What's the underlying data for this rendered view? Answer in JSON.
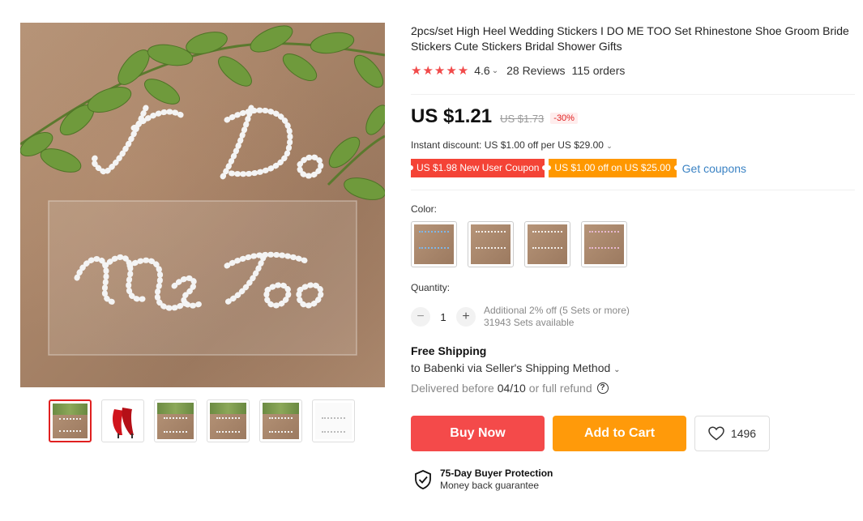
{
  "gallery": {
    "main_image": "rhinestone-stickers-i-do-me-too-photo",
    "thumbnails": [
      {
        "name": "thumb-1",
        "kind": "stickers",
        "active": true
      },
      {
        "name": "thumb-2",
        "kind": "red-heels",
        "active": false
      },
      {
        "name": "thumb-3",
        "kind": "stickers",
        "active": false
      },
      {
        "name": "thumb-4",
        "kind": "stickers",
        "active": false
      },
      {
        "name": "thumb-5",
        "kind": "stickers",
        "active": false
      },
      {
        "name": "thumb-6",
        "kind": "stickers-white",
        "active": false
      }
    ]
  },
  "product": {
    "title": "2pcs/set High Heel Wedding Stickers I DO ME TOO Set Rhinestone Shoe Groom Bride Stickers Cute Stickers Bridal Shower Gifts",
    "rating": {
      "stars": "★★★★★",
      "score": "4.6",
      "reviews": "28 Reviews",
      "orders": "115 orders"
    },
    "price": {
      "current": "US $1.21",
      "original": "US $1.73",
      "discount": "-30%"
    },
    "instant_discount": "Instant discount: US $1.00 off per US $29.00",
    "coupons": [
      {
        "label": "US $1.98 New User Coupon",
        "color": "#f44336"
      },
      {
        "label": "US $1.00 off on US $25.00",
        "color": "#ff9800"
      }
    ],
    "get_coupons": "Get coupons",
    "color_label": "Color:",
    "quantity_label": "Quantity:",
    "quantity": {
      "minus": "−",
      "value": "1",
      "plus": "+",
      "note1": "Additional 2% off (5 Sets or more)",
      "note2": "31943 Sets available"
    },
    "shipping": {
      "title": "Free Shipping",
      "to": "to Babenki via Seller's Shipping Method",
      "delivered_prefix": "Delivered before",
      "date": "04/10",
      "delivered_suffix": "or full refund",
      "help": "?"
    },
    "actions": {
      "buy_now": "Buy Now",
      "add_to_cart": "Add to Cart",
      "wishlist_count": "1496"
    },
    "protection": {
      "title": "75-Day Buyer Protection",
      "subtitle": "Money back guarantee"
    }
  },
  "colors": {
    "accent_red": "#f44a4a",
    "accent_orange": "#ff9a0a",
    "link_blue": "#3b83c4",
    "star_red": "#f14a4a"
  }
}
